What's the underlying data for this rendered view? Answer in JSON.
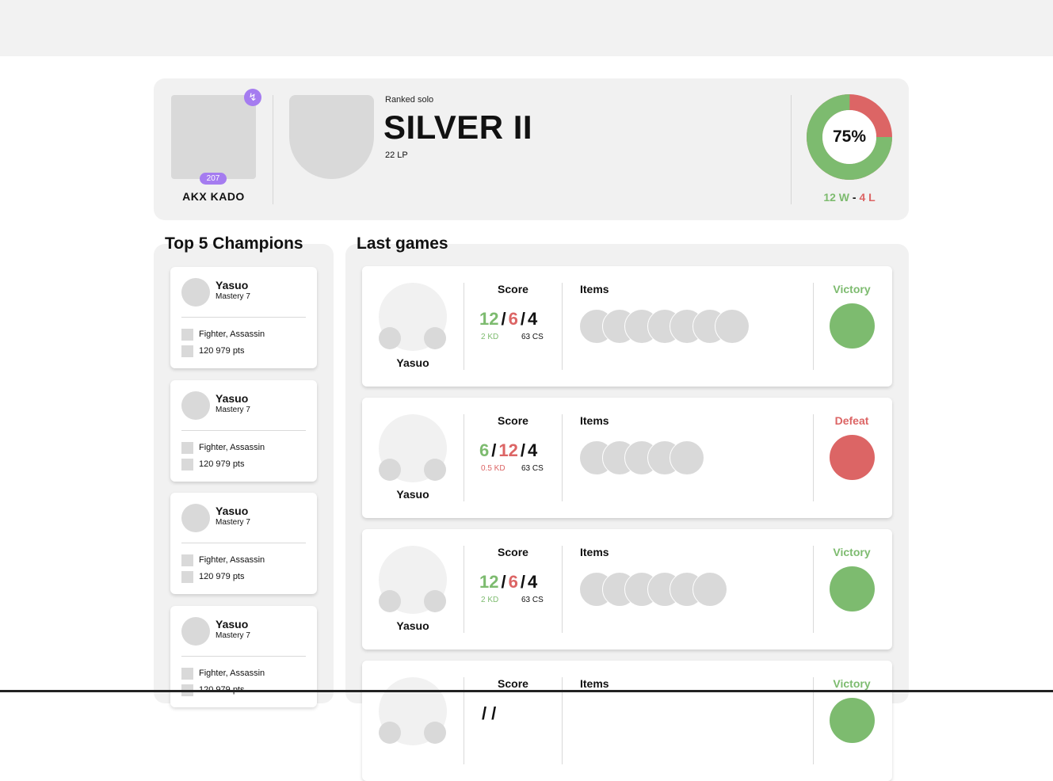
{
  "colors": {
    "win": "#7dbb6f",
    "loss": "#dc6565",
    "accent": "#a57cf0"
  },
  "profile": {
    "avatar_badge_icon": "lightning-icon",
    "level": "207",
    "summoner_name": "AKX KADO",
    "queue": "Ranked solo",
    "tier": "SILVER II",
    "lp": "22 LP",
    "winrate_label": "75%",
    "winrate": 0.75,
    "wins": "12 W",
    "separator": "-",
    "losses": "4 L"
  },
  "champions_title": "Top 5 Champions",
  "champions": [
    {
      "name": "Yasuo",
      "mastery": "Mastery 7",
      "role": "Fighter, Assassin",
      "points": "120 979 pts"
    },
    {
      "name": "Yasuo",
      "mastery": "Mastery 7",
      "role": "Fighter, Assassin",
      "points": "120 979 pts"
    },
    {
      "name": "Yasuo",
      "mastery": "Mastery 7",
      "role": "Fighter, Assassin",
      "points": "120 979 pts"
    },
    {
      "name": "Yasuo",
      "mastery": "Mastery 7",
      "role": "Fighter, Assassin",
      "points": "120 979 pts"
    }
  ],
  "games_title": "Last games",
  "games": [
    {
      "champion": "Yasuo",
      "score_label": "Score",
      "kills": "12",
      "deaths": "6",
      "assists": "4",
      "kd": "2 KD",
      "cs": "63 CS",
      "items_label": "Items",
      "item_count": 7,
      "result": "Victory",
      "win": true
    },
    {
      "champion": "Yasuo",
      "score_label": "Score",
      "kills": "6",
      "deaths": "12",
      "assists": "4",
      "kd": "0.5 KD",
      "cs": "63 CS",
      "items_label": "Items",
      "item_count": 5,
      "result": "Defeat",
      "win": false
    },
    {
      "champion": "Yasuo",
      "score_label": "Score",
      "kills": "12",
      "deaths": "6",
      "assists": "4",
      "kd": "2 KD",
      "cs": "63 CS",
      "items_label": "Items",
      "item_count": 6,
      "result": "Victory",
      "win": true
    },
    {
      "champion": "",
      "score_label": "Score",
      "kills": "",
      "deaths": "",
      "assists": "",
      "kd": "",
      "cs": "",
      "items_label": "Items",
      "item_count": 0,
      "result": "Victory",
      "win": true
    }
  ]
}
